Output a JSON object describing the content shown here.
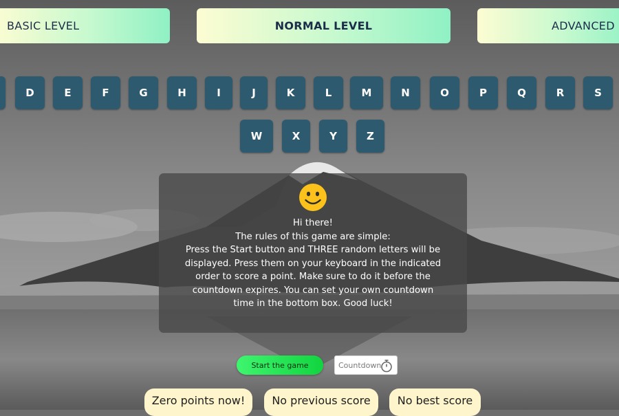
{
  "levels": {
    "basic": "BASIC LEVEL",
    "normal": "NORMAL LEVEL",
    "advanced": "ADVANCED"
  },
  "keys_row1": [
    "D",
    "E",
    "F",
    "G",
    "H",
    "I",
    "J",
    "K",
    "L",
    "M",
    "N",
    "O",
    "P",
    "Q",
    "R",
    "S"
  ],
  "keys_row2": [
    "W",
    "X",
    "Y",
    "Z"
  ],
  "rules": {
    "emoji": "smiley-face-icon",
    "lines": [
      "Hi there!",
      "The rules of this game are simple:",
      "Press the Start button and THREE random letters will be displayed. Press them on your keyboard in the indicated order to score a point. Make sure to do it before the countdown expires. You can set your own countdown time in the bottom box. Good luck!"
    ]
  },
  "controls": {
    "start_label": "Start the game",
    "countdown_placeholder": "Countdown",
    "countdown_icon": "stopwatch-icon"
  },
  "scores": {
    "current": "Zero points now!",
    "previous": "No previous score",
    "best": "No best score"
  },
  "colors": {
    "key_bg": "#2d5a6e",
    "level_gradient_start": "#fdfcd2",
    "level_gradient_end": "#8ff1c4",
    "start_button": "#2ee85a",
    "score_pill": "#fff5cc"
  }
}
